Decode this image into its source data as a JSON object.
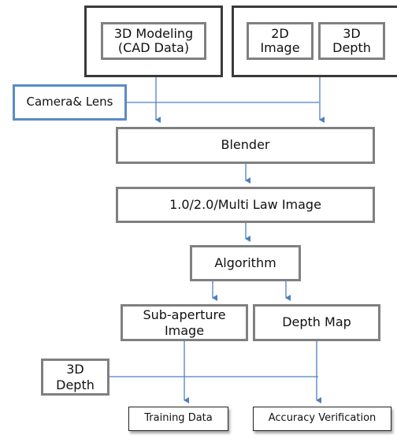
{
  "diagram": {
    "nodes": {
      "modeling": "3D Modeling\n(CAD Data)",
      "image2d": "2D\nImage",
      "depth3d_top": "3D\nDepth",
      "camera": "Camera& Lens",
      "blender": "Blender",
      "law_image": "1.0/2.0/Multi Law Image",
      "algorithm": "Algorithm",
      "sub_aperture": "Sub-aperture\nImage",
      "depth_map": "Depth Map",
      "depth3d_bottom": "3D\nDepth",
      "training": "Training Data",
      "accuracy": "Accuracy Verification"
    },
    "edges": [
      {
        "from": "modeling",
        "to": "blender"
      },
      {
        "from": "image2d/depth3d_top",
        "to": "blender"
      },
      {
        "from": "camera",
        "to": "blender"
      },
      {
        "from": "blender",
        "to": "law_image"
      },
      {
        "from": "law_image",
        "to": "algorithm"
      },
      {
        "from": "algorithm",
        "to": "sub_aperture"
      },
      {
        "from": "algorithm",
        "to": "depth_map"
      },
      {
        "from": "sub_aperture",
        "to": "training"
      },
      {
        "from": "depth_map",
        "to": "accuracy"
      },
      {
        "from": "depth3d_bottom",
        "to": "training/accuracy"
      }
    ],
    "colors": {
      "connector": "#4f7fbf",
      "outer_border": "#3a3a3a",
      "box_border": "#808080",
      "camera_border": "#5b8bc9"
    }
  }
}
